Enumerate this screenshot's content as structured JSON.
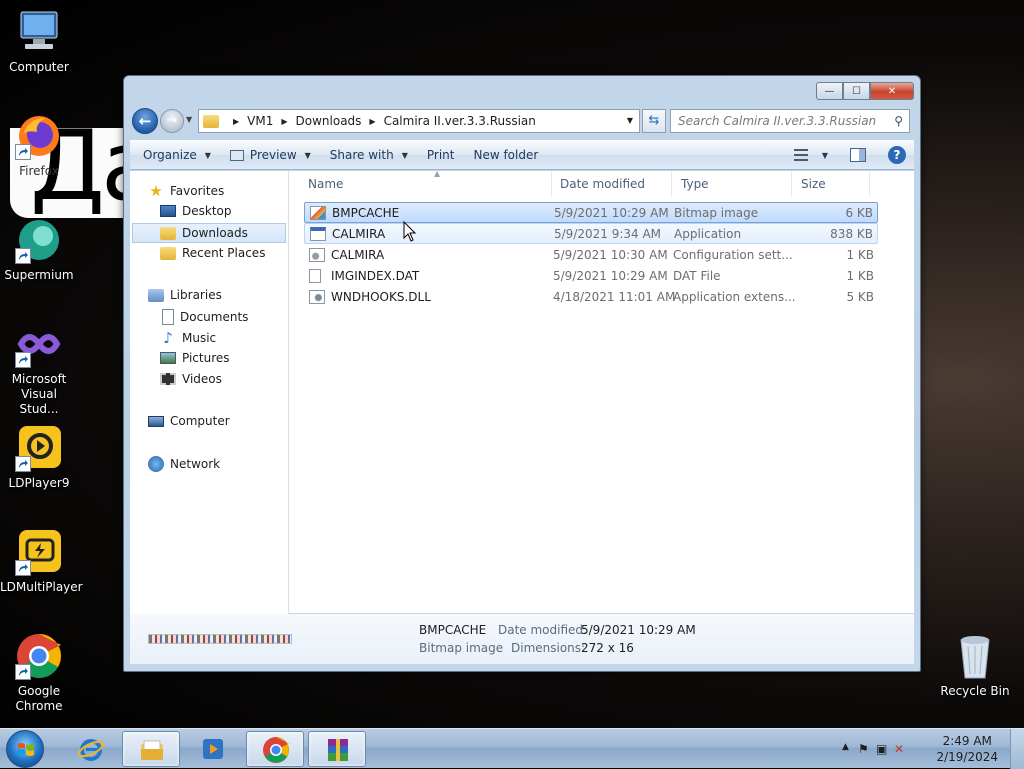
{
  "desktop": {
    "wallpaper_text": "Да",
    "icons": [
      {
        "label": "Computer",
        "icon": "computer-icon"
      },
      {
        "label": "Firefox",
        "icon": "firefox-icon"
      },
      {
        "label": "Supermium",
        "icon": "supermium-icon"
      },
      {
        "label": "Microsoft Visual Stud...",
        "icon": "visual-studio-icon"
      },
      {
        "label": "LDPlayer9",
        "icon": "ldplayer-icon"
      },
      {
        "label": "LDMultiPlayer",
        "icon": "ldmultiplayer-icon"
      },
      {
        "label": "Google Chrome",
        "icon": "chrome-icon"
      },
      {
        "label": "Recycle Bin",
        "icon": "recycle-bin-icon"
      }
    ]
  },
  "window": {
    "controls": {
      "minimize": "—",
      "maximize": "☐",
      "close": "✕"
    },
    "breadcrumb": [
      "VM1",
      "Downloads",
      "Calmira II.ver.3.3.Russian"
    ],
    "search_placeholder": "Search Calmira II.ver.3.3.Russian",
    "toolbar": {
      "organize": "Organize",
      "preview": "Preview",
      "share_with": "Share with",
      "print": "Print",
      "new_folder": "New folder"
    },
    "nav_pane": {
      "favorites": "Favorites",
      "desktop": "Desktop",
      "downloads": "Downloads",
      "recent_places": "Recent Places",
      "libraries": "Libraries",
      "documents": "Documents",
      "music": "Music",
      "pictures": "Pictures",
      "videos": "Videos",
      "computer": "Computer",
      "network": "Network"
    },
    "columns": {
      "name": "Name",
      "date_modified": "Date modified",
      "type": "Type",
      "size": "Size"
    },
    "files": [
      {
        "name": "BMPCACHE",
        "date": "5/9/2021 10:29 AM",
        "type": "Bitmap image",
        "size": "6 KB",
        "icon": "bitmap-file-icon"
      },
      {
        "name": "CALMIRA",
        "date": "5/9/2021 9:34 AM",
        "type": "Application",
        "size": "838 KB",
        "icon": "application-file-icon"
      },
      {
        "name": "CALMIRA",
        "date": "5/9/2021 10:30 AM",
        "type": "Configuration sett...",
        "size": "1 KB",
        "icon": "config-file-icon"
      },
      {
        "name": "IMGINDEX.DAT",
        "date": "5/9/2021 10:29 AM",
        "type": "DAT File",
        "size": "1 KB",
        "icon": "dat-file-icon"
      },
      {
        "name": "WNDHOOKS.DLL",
        "date": "4/18/2021 11:01 AM",
        "type": "Application extens...",
        "size": "5 KB",
        "icon": "dll-file-icon"
      }
    ],
    "details": {
      "name": "BMPCACHE",
      "type": "Bitmap image",
      "date_modified_label": "Date modified:",
      "date_modified_value": "5/9/2021 10:29 AM",
      "dimensions_label": "Dimensions:",
      "dimensions_value": "272 x 16"
    }
  },
  "taskbar": {
    "clock_time": "2:49 AM",
    "clock_date": "2/19/2024",
    "pinned": [
      "internet-explorer-icon",
      "windows-explorer-icon",
      "media-player-icon",
      "chrome-icon",
      "winrar-icon"
    ]
  },
  "colors": {
    "accent": "#2c69b5",
    "selection": "#c1dbfc",
    "taskbar": "#9db7d4"
  }
}
